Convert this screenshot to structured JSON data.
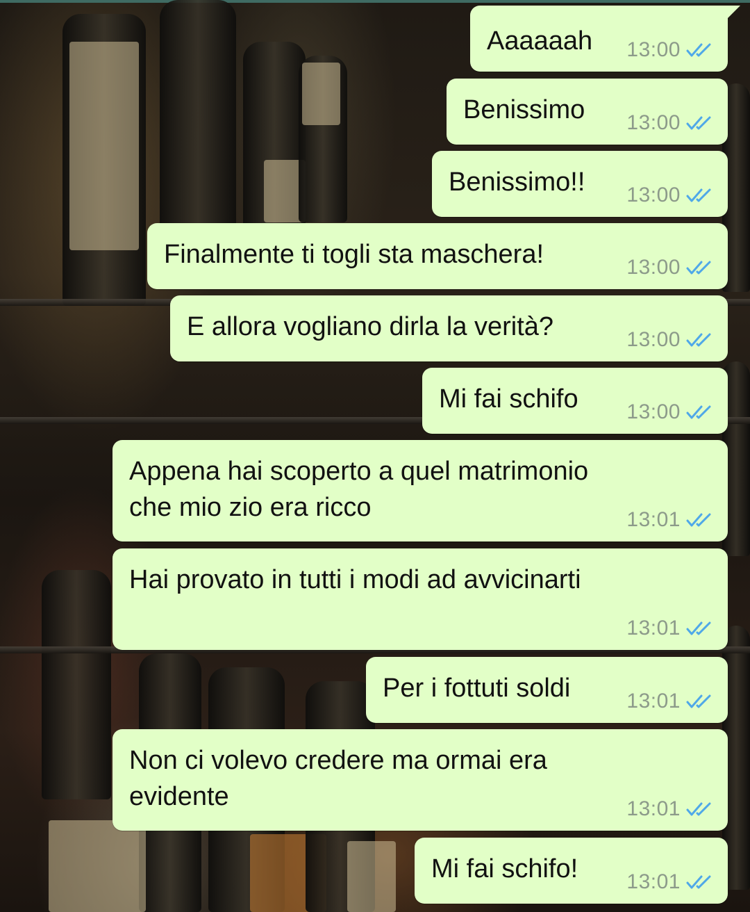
{
  "colors": {
    "bubble": "#e2ffc7",
    "time_text": "#8c9a8a",
    "read_ticks": "#4fa8e8"
  },
  "icons": {
    "read_receipt": "double-check-icon"
  },
  "messages": [
    {
      "text": "Aaaaaah",
      "time": "13:00",
      "status": "read"
    },
    {
      "text": "Benissimo",
      "time": "13:00",
      "status": "read"
    },
    {
      "text": "Benissimo!!",
      "time": "13:00",
      "status": "read"
    },
    {
      "text": "Finalmente ti togli sta maschera!",
      "time": "13:00",
      "status": "read"
    },
    {
      "text": "E allora vogliano dirla la verità?",
      "time": "13:00",
      "status": "read"
    },
    {
      "text": "Mi fai schifo",
      "time": "13:00",
      "status": "read"
    },
    {
      "text": "Appena hai scoperto a quel matrimonio",
      "text_line2": "che mio zio era ricco",
      "time": "13:01",
      "status": "read"
    },
    {
      "text": "Hai provato in tutti i modi ad avvicinarti",
      "time": "13:01",
      "status": "read"
    },
    {
      "text": "Per i fottuti soldi",
      "time": "13:01",
      "status": "read"
    },
    {
      "text": "Non ci volevo credere ma ormai era",
      "text_line2": "evidente",
      "time": "13:01",
      "status": "read"
    },
    {
      "text": "Mi fai schifo!",
      "time": "13:01",
      "status": "read"
    }
  ]
}
